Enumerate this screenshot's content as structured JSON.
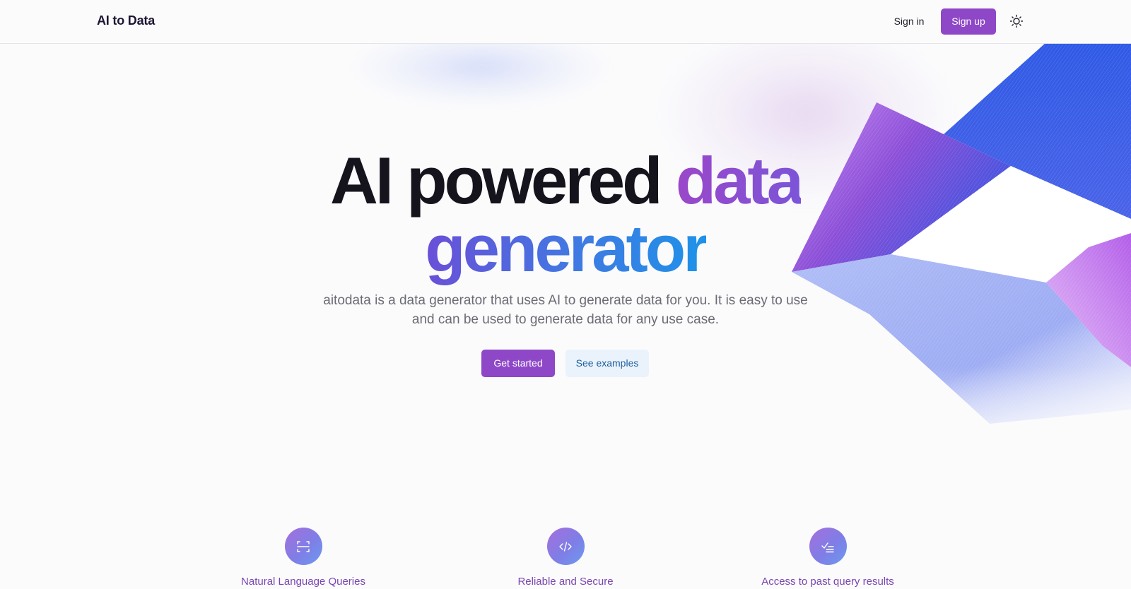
{
  "header": {
    "brand": "AI to Data",
    "signin_label": "Sign in",
    "signup_label": "Sign up",
    "theme_icon": "sun-icon"
  },
  "hero": {
    "title_plain": "AI powered",
    "title_accent_1": "data",
    "title_accent_2": "generator",
    "description": "aitodata is a data generator that uses AI to generate data for you. It is easy to use and can be used to generate data for any use case.",
    "primary_cta": "Get started",
    "secondary_cta": "See examples"
  },
  "features": [
    {
      "label": "Natural Language Queries",
      "icon": "scan-icon"
    },
    {
      "label": "Reliable and Secure",
      "icon": "code-icon"
    },
    {
      "label": "Access to past query results",
      "icon": "checklist-icon"
    }
  ],
  "colors": {
    "accent": "#8e48c7",
    "secondary_button_bg": "#eaf3fc",
    "secondary_button_text": "#1f5f9a",
    "feature_text": "#7a46b0"
  }
}
